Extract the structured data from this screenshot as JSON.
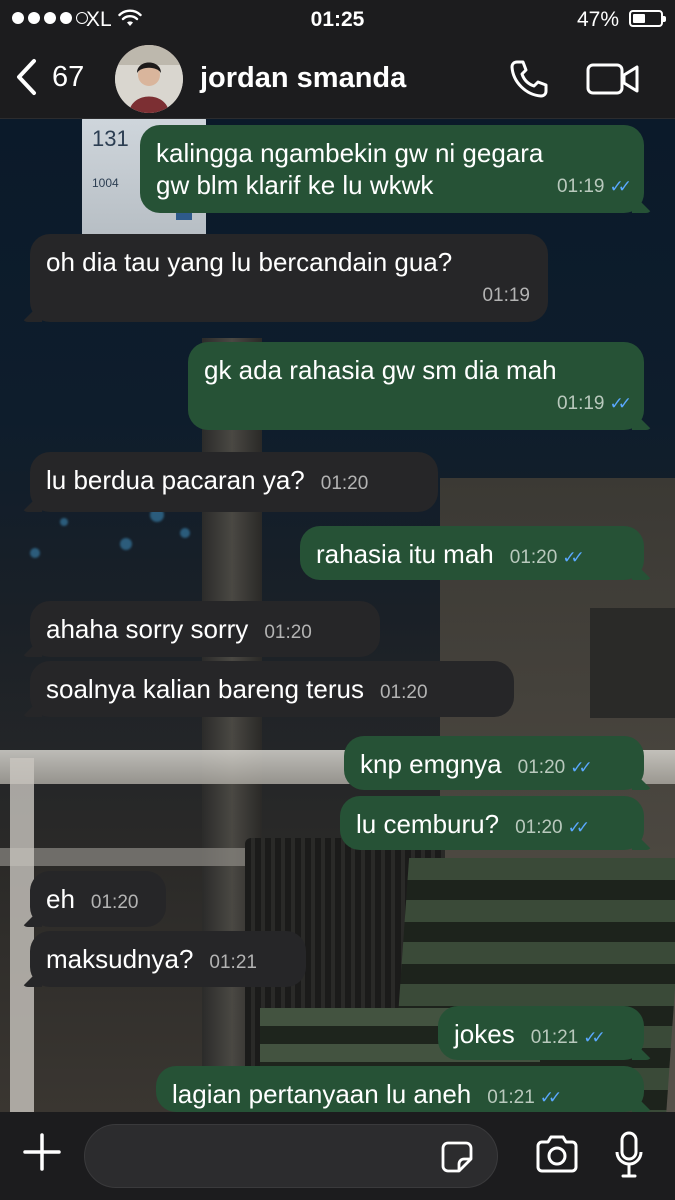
{
  "status_bar": {
    "carrier": "XL",
    "time": "01:25",
    "battery_percent": "47%",
    "battery_level": 0.47,
    "signal_filled": 4,
    "signal_total": 5
  },
  "header": {
    "back_count": "67",
    "contact_name": "jordan smanda"
  },
  "background_sign": {
    "number": "131",
    "code": "1004"
  },
  "messages": [
    {
      "dir": "out",
      "lines": [
        "kalingga ngambekin gw ni gegara",
        "gw blm klarif ke lu wkwk"
      ],
      "time": "01:19",
      "read": true
    },
    {
      "dir": "in",
      "lines": [
        "oh dia tau yang lu bercandain gua?"
      ],
      "time": "01:19"
    },
    {
      "dir": "out",
      "lines": [
        "gk ada rahasia gw sm dia mah"
      ],
      "time": "01:19",
      "read": true
    },
    {
      "dir": "in",
      "lines": [
        "lu berdua pacaran ya?"
      ],
      "time": "01:20"
    },
    {
      "dir": "out",
      "lines": [
        "rahasia itu mah"
      ],
      "time": "01:20",
      "read": true
    },
    {
      "dir": "in",
      "lines": [
        "ahaha sorry sorry"
      ],
      "time": "01:20"
    },
    {
      "dir": "in",
      "lines": [
        "soalnya kalian bareng terus"
      ],
      "time": "01:20"
    },
    {
      "dir": "out",
      "lines": [
        "knp emgnya"
      ],
      "time": "01:20",
      "read": true
    },
    {
      "dir": "out",
      "lines": [
        "lu cemburu?"
      ],
      "time": "01:20",
      "read": true
    },
    {
      "dir": "in",
      "lines": [
        "eh"
      ],
      "time": "01:20"
    },
    {
      "dir": "in",
      "lines": [
        "maksudnya?"
      ],
      "time": "01:21"
    },
    {
      "dir": "out",
      "lines": [
        "jokes"
      ],
      "time": "01:21",
      "read": true
    },
    {
      "dir": "out",
      "lines": [
        "lagian pertanyaan lu aneh"
      ],
      "time": "01:21",
      "read": true
    }
  ],
  "input": {
    "value": "",
    "placeholder": ""
  },
  "colors": {
    "incoming_bubble": "#262628",
    "outgoing_bubble": "#265236",
    "read_ticks": "#5aa8ff",
    "bar_bg": "#1c1c1e"
  },
  "icons": {
    "back": "chevron-left-icon",
    "call": "phone-icon",
    "video": "video-camera-icon",
    "add": "plus-icon",
    "sticker": "sticker-icon",
    "camera": "camera-icon",
    "mic": "microphone-icon"
  }
}
